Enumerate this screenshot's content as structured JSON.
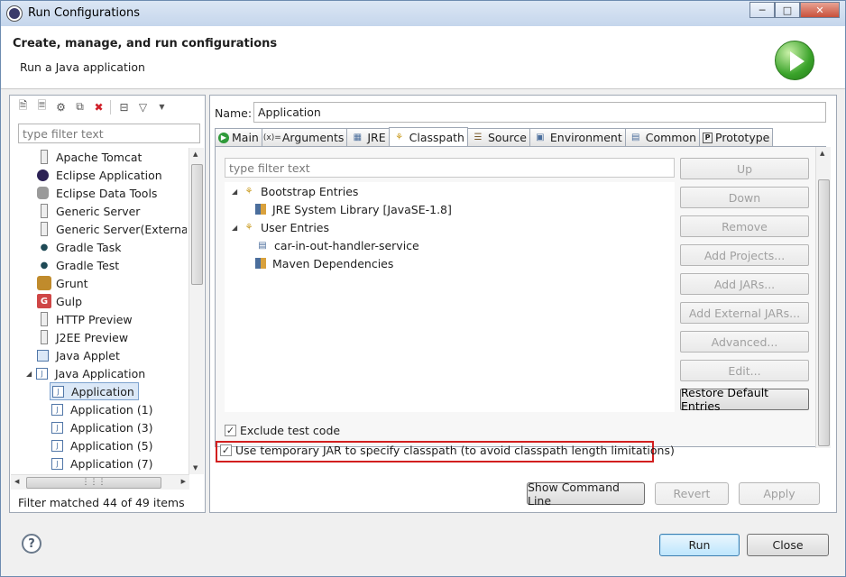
{
  "window": {
    "title": "Run Configurations"
  },
  "header": {
    "title": "Create, manage, and run configurations",
    "subtitle": "Run a Java application"
  },
  "left": {
    "filter_placeholder": "type filter text",
    "items": [
      {
        "label": "Apache Tomcat",
        "icon": "tomcat-icon"
      },
      {
        "label": "Eclipse Application",
        "icon": "eclipse-icon"
      },
      {
        "label": "Eclipse Data Tools",
        "icon": "database-icon"
      },
      {
        "label": "Generic Server",
        "icon": "server-icon"
      },
      {
        "label": "Generic Server(External L",
        "icon": "server-icon"
      },
      {
        "label": "Gradle Task",
        "icon": "gradle-icon"
      },
      {
        "label": "Gradle Test",
        "icon": "gradle-icon"
      },
      {
        "label": "Grunt",
        "icon": "grunt-icon"
      },
      {
        "label": "Gulp",
        "icon": "gulp-icon"
      },
      {
        "label": "HTTP Preview",
        "icon": "server-icon"
      },
      {
        "label": "J2EE Preview",
        "icon": "server-icon"
      },
      {
        "label": "Java Applet",
        "icon": "applet-icon"
      },
      {
        "label": "Java Application",
        "icon": "java-app-icon"
      },
      {
        "label": "Application",
        "icon": "java-config-icon"
      },
      {
        "label": "Application (1)",
        "icon": "java-config-icon"
      },
      {
        "label": "Application (3)",
        "icon": "java-config-icon"
      },
      {
        "label": "Application (5)",
        "icon": "java-config-icon"
      },
      {
        "label": "Application (7)",
        "icon": "java-config-icon"
      }
    ],
    "filter_message": "Filter matched 44 of 49 items"
  },
  "name": {
    "label": "Name:",
    "value": "Application"
  },
  "tabs": [
    {
      "label": "Main",
      "icon": "main-tab-icon"
    },
    {
      "label": "Arguments",
      "icon": "arguments-icon"
    },
    {
      "label": "JRE",
      "icon": "jre-icon"
    },
    {
      "label": "Classpath",
      "icon": "classpath-icon"
    },
    {
      "label": "Source",
      "icon": "source-icon"
    },
    {
      "label": "Environment",
      "icon": "environment-icon"
    },
    {
      "label": "Common",
      "icon": "common-icon"
    },
    {
      "label": "Prototype",
      "icon": "prototype-icon"
    }
  ],
  "classpath": {
    "filter_placeholder": "type filter text",
    "entries": [
      {
        "label": "Bootstrap Entries"
      },
      {
        "label": "JRE System Library [JavaSE-1.8]"
      },
      {
        "label": "User Entries"
      },
      {
        "label": "car-in-out-handler-service"
      },
      {
        "label": "Maven Dependencies"
      }
    ],
    "buttons": [
      "Up",
      "Down",
      "Remove",
      "Add Projects...",
      "Add JARs...",
      "Add External JARs...",
      "Advanced...",
      "Edit...",
      "Restore Default Entries"
    ],
    "exclude_test_code": "Exclude test code",
    "temp_jar": "Use temporary JAR to specify classpath (to avoid classpath length limitations)"
  },
  "bottom": {
    "show_command_line": "Show Command Line",
    "revert": "Revert",
    "apply": "Apply",
    "run": "Run",
    "close": "Close"
  }
}
